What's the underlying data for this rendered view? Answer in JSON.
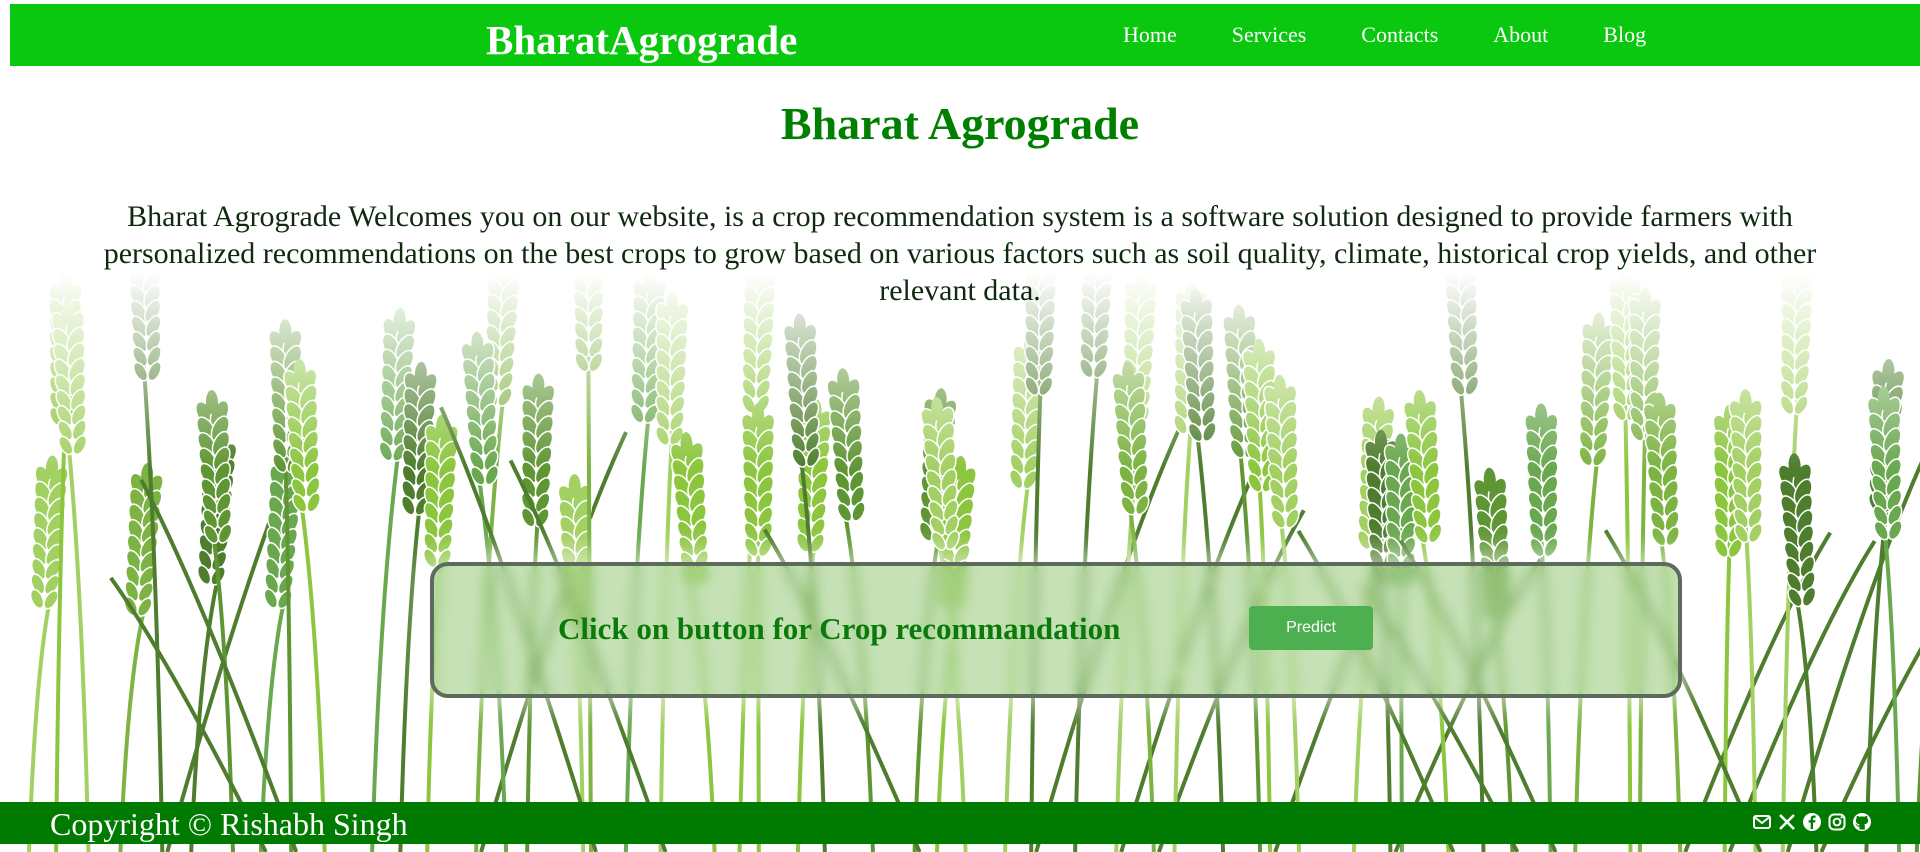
{
  "navbar": {
    "brand": "BharatAgrograde",
    "links": [
      "Home",
      "Services",
      "Contacts",
      "About",
      "Blog"
    ]
  },
  "hero": {
    "title": "Bharat Agrograde",
    "description": "Bharat Agrograde Welcomes you on our website, is a crop recommendation system is a software solution designed to provide farmers with personalized recommendations on the best crops to grow based on various factors such as soil quality, climate, historical crop yields, and other relevant data."
  },
  "card": {
    "text": "Click on button for Crop recommandation",
    "button_label": "Predict"
  },
  "footer": {
    "copyright": "Copyright © Rishabh Singh",
    "social_icons": [
      "mail-icon",
      "x-icon",
      "facebook-icon",
      "instagram-icon",
      "github-icon"
    ]
  },
  "colors": {
    "navbar": "#0ac80f",
    "title": "#008000",
    "button": "#4caf50",
    "footer": "#007a00"
  }
}
